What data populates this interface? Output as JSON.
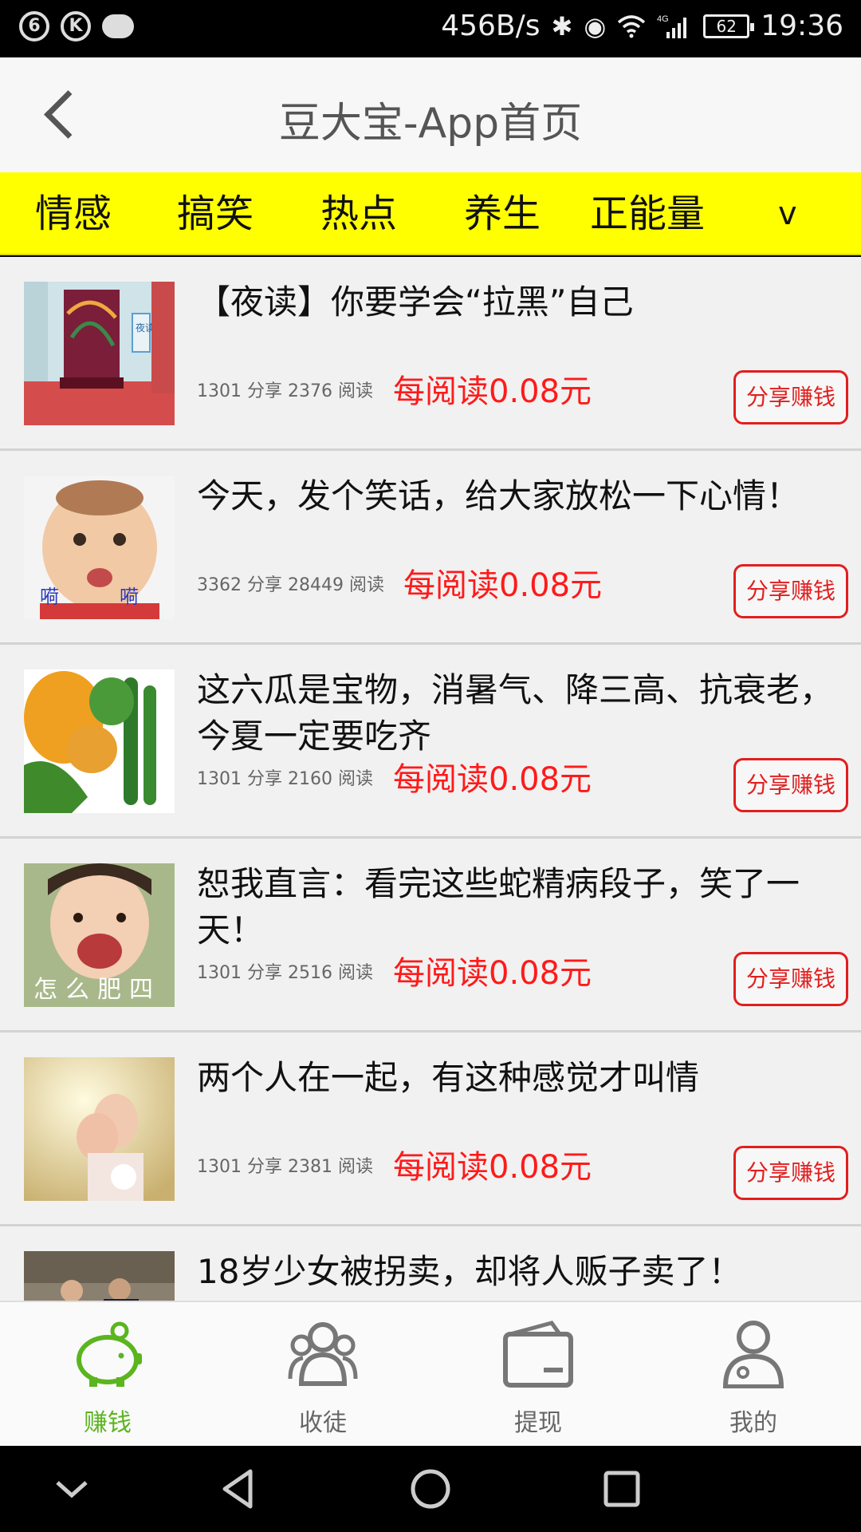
{
  "status_bar": {
    "net_speed": "456B/s",
    "battery": "62",
    "time": "19:36",
    "network_type": "4G",
    "left_icons": [
      "ring-app-icon",
      "k-app-icon",
      "message-bubble-icon"
    ],
    "right_icons": [
      "bluetooth-icon",
      "eye-icon",
      "wifi-icon",
      "signal-icon"
    ]
  },
  "header": {
    "title": "豆大宝-App首页",
    "back_icon": "chevron-left-icon"
  },
  "tabs": [
    "情感",
    "搞笑",
    "热点",
    "养生",
    "正能量"
  ],
  "tabs_more": "v",
  "articles": [
    {
      "title": "【夜读】你要学会“拉黑”自己",
      "stats": "1301 分享   2376 阅读",
      "reward": "每阅读0.08元",
      "button": "分享赚钱"
    },
    {
      "title": "今天，发个笑话，给大家放松一下心情！",
      "stats": "3362 分享   28449 阅读",
      "reward": "每阅读0.08元",
      "button": "分享赚钱"
    },
    {
      "title": "这六瓜是宝物，消暑气、降三高、抗衰老，今夏一定要吃齐",
      "stats": "1301 分享   2160 阅读",
      "reward": "每阅读0.08元",
      "button": "分享赚钱"
    },
    {
      "title": "恕我直言：看完这些蛇精病段子，笑了一天！",
      "stats": "1301 分享   2516 阅读",
      "reward": "每阅读0.08元",
      "button": "分享赚钱"
    },
    {
      "title": "两个人在一起，有这种感觉才叫情",
      "stats": "1301 分享   2381 阅读",
      "reward": "每阅读0.08元",
      "button": "分享赚钱"
    },
    {
      "title": "18岁少女被拐卖，却将人贩子卖了！",
      "stats": "",
      "reward": "",
      "button": ""
    }
  ],
  "thumb_captions": {
    "item1": "夜读",
    "item2": "嗬嗬",
    "item4": "怎么肥四"
  },
  "bottom_nav": [
    {
      "label": "赚钱",
      "icon": "piggy-bank-icon",
      "active": true
    },
    {
      "label": "收徒",
      "icon": "group-users-icon",
      "active": false
    },
    {
      "label": "提现",
      "icon": "wallet-icon",
      "active": false
    },
    {
      "label": "我的",
      "icon": "user-profile-icon",
      "active": false
    }
  ],
  "colors": {
    "tab_bar": "#ffff00",
    "reward_red": "#ff1a1a",
    "active_green": "#5bb51f",
    "header_bg": "#f7f7f7"
  }
}
